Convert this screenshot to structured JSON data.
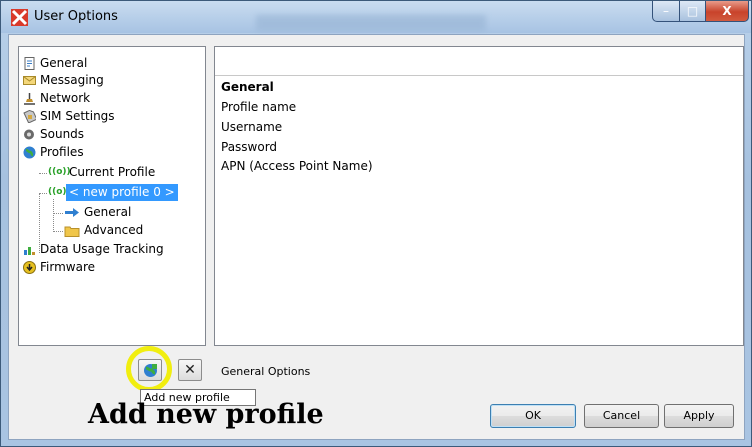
{
  "window": {
    "title": "User Options",
    "minimize_symbol": "–",
    "maximize_symbol": "□",
    "close_symbol": "X"
  },
  "tree": {
    "items": [
      {
        "label": "General",
        "icon": "document-icon"
      },
      {
        "label": "Messaging",
        "icon": "envelope-icon"
      },
      {
        "label": "Network",
        "icon": "network-icon"
      },
      {
        "label": "SIM Settings",
        "icon": "sim-card-icon"
      },
      {
        "label": "Sounds",
        "icon": "speaker-icon"
      },
      {
        "label": "Profiles",
        "icon": "globe-icon"
      },
      {
        "label": "Current Profile",
        "icon": "antenna-icon"
      },
      {
        "label": "< new profile 0 >",
        "icon": "antenna-icon",
        "selected": true
      },
      {
        "label": "General",
        "icon": "arrow-right-icon"
      },
      {
        "label": "Advanced",
        "icon": "folder-icon"
      },
      {
        "label": "Data Usage Tracking",
        "icon": "chart-icon"
      },
      {
        "label": "Firmware",
        "icon": "download-icon"
      }
    ]
  },
  "panel": {
    "heading": "General",
    "fields": [
      "Profile name",
      "Username",
      "Password",
      "APN (Access Point Name)"
    ]
  },
  "toolbar": {
    "add_profile_icon": "add-profile-icon",
    "delete_symbol": "✕",
    "status_text": "General Options",
    "tooltip": "Add new profile"
  },
  "annotation": {
    "caption": "Add new profile",
    "highlight_color": "#f1ee0f"
  },
  "buttons": {
    "ok": "OK",
    "cancel": "Cancel",
    "apply": "Apply"
  },
  "colors": {
    "selection": "#3399ff",
    "title_bar": "#a7c3e3"
  }
}
